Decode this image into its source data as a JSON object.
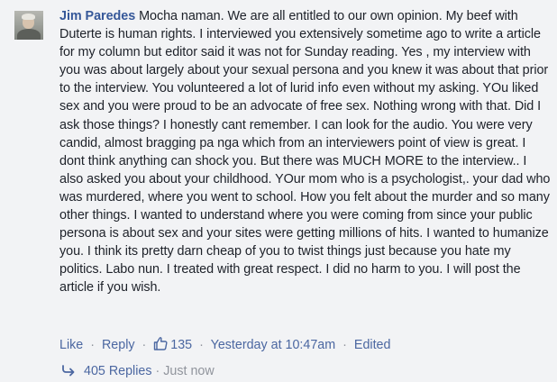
{
  "comment": {
    "author": "Jim Paredes",
    "text": "Mocha naman. We are all entitled to our own opinion. My beef with Duterte is human rights. I interviewed you extensively sometime ago to write a article for my column but editor said it was not for Sunday reading. Yes , my interview with you was about largely about your sexual persona and you knew it was about that prior to the interview. You volunteered a lot of lurid info even without my asking. YOu liked sex and you were proud to be an advocate of free sex. Nothing wrong with that. Did I ask those things? I honestly cant remember. I can look for the audio. You were very candid, almost bragging pa nga which from an interviewers point of view is great. I dont think anything can shock you. But there was MUCH MORE to the interview.. I also asked you about your childhood. YOur mom who is a psychologist,. your dad who was murdered, where you went to school. How you felt about the murder and so many other things. I wanted to understand where you were coming from since your public persona is about sex and your sites were getting millions of hits. I wanted to humanize you. I think its pretty darn cheap of you to twist things just because you hate my politics. Labo nun. I treated with great respect. I did no harm to you. I will post the article if you wish."
  },
  "actions": {
    "like_label": "Like",
    "separator": "·",
    "reply_label": "Reply",
    "like_count": "135",
    "timestamp": "Yesterday at 10:47am",
    "edited_label": "Edited"
  },
  "replies": {
    "label": "405 Replies",
    "separator": "·",
    "time": "Just now"
  },
  "colors": {
    "background": "#f2f3f5",
    "author_link": "#365899",
    "action_link": "#4b67a1",
    "muted_text": "#90949c",
    "body_text": "#1d2129"
  },
  "icons": {
    "avatar": "profile-photo",
    "like": "thumbs-up-icon",
    "reply_arrow": "reply-arrow-icon"
  }
}
